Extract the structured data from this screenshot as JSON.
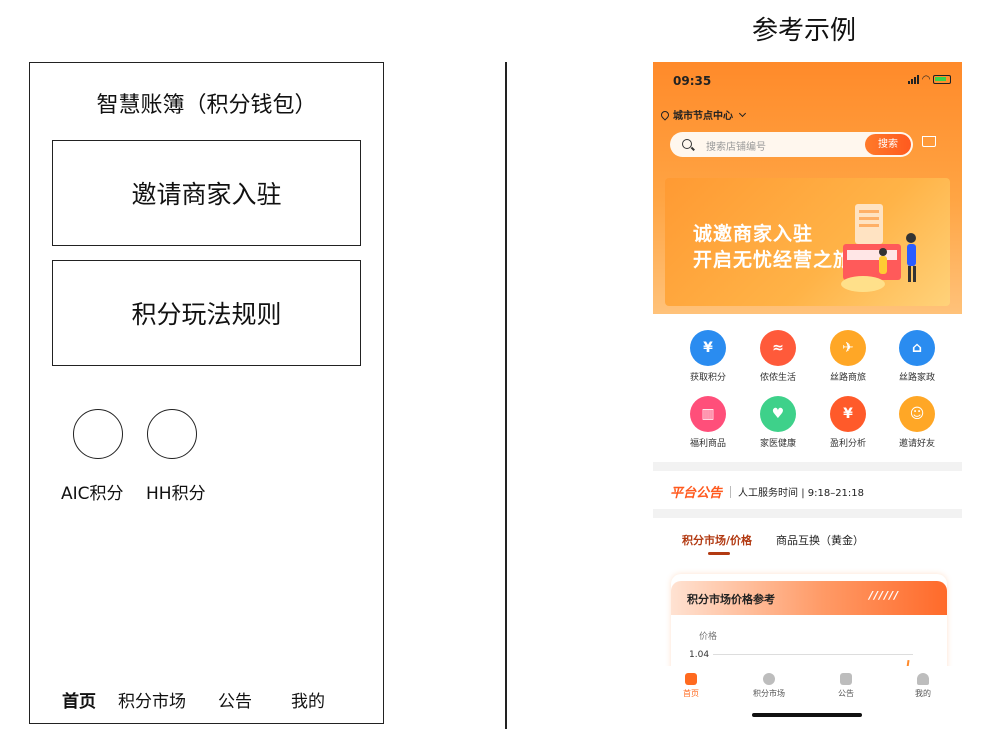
{
  "wireframe": {
    "title": "智慧账簿（积分钱包）",
    "box1": "邀请商家入驻",
    "box2": "积分玩法规则",
    "circles": [
      "AIC积分",
      "HH积分"
    ],
    "nav": [
      "首页",
      "积分市场",
      "公告",
      "我的"
    ]
  },
  "reference": {
    "heading": "参考示例",
    "status_time": "09:35",
    "location": "城市节点中心",
    "search_placeholder": "搜索店铺编号",
    "search_button": "搜索",
    "banner_line1": "诚邀商家入驻",
    "banner_line2": "开启无忧经营之旅",
    "grid": [
      {
        "label": "获取积分",
        "icon": "yuan-hand-icon",
        "color": "#2a8cf0",
        "glyph": "¥"
      },
      {
        "label": "侬侬生活",
        "icon": "shrimp-icon",
        "color": "#ff5a3a",
        "glyph": "≈"
      },
      {
        "label": "丝路商旅",
        "icon": "plane-icon",
        "color": "#ffa726",
        "glyph": "✈"
      },
      {
        "label": "丝路家政",
        "icon": "house-heart-icon",
        "color": "#2a8cf0",
        "glyph": "⌂"
      },
      {
        "label": "福利商品",
        "icon": "basket-icon",
        "color": "#ff4f7a",
        "glyph": "▥"
      },
      {
        "label": "家医健康",
        "icon": "heart-plus-icon",
        "color": "#3ed18a",
        "glyph": "♥"
      },
      {
        "label": "盈利分析",
        "icon": "money-bag-icon",
        "color": "#ff5a2a",
        "glyph": "¥"
      },
      {
        "label": "邀请好友",
        "icon": "user-add-icon",
        "color": "#ffa726",
        "glyph": "☺"
      }
    ],
    "notice_logo": "平台公告",
    "notice_text": "人工服务时间 | 9:18–21:18",
    "tabs": [
      "积分市场/价格",
      "商品互换（黄金）"
    ],
    "card_title": "积分市场价格参考",
    "card_price_label": "价格",
    "card_y_tick": "1.04",
    "tabbar": [
      "首页",
      "积分市场",
      "公告",
      "我的"
    ],
    "accent": "#ff6a1f"
  }
}
